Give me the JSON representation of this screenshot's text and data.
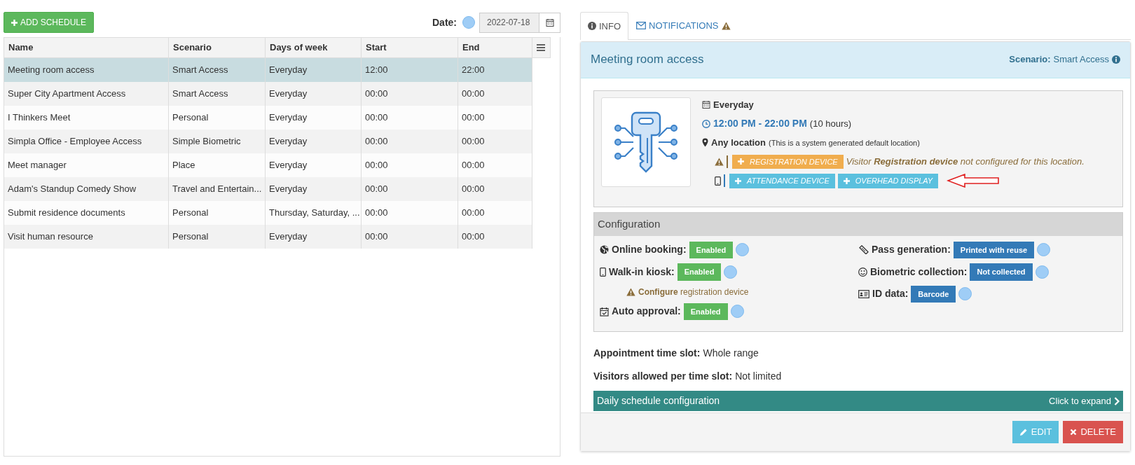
{
  "toolbar": {
    "add_button": "ADD SCHEDULE",
    "date_label": "Date:",
    "date_value": "2022-07-18"
  },
  "table": {
    "columns": [
      "Name",
      "Scenario",
      "Days of week",
      "Start",
      "End"
    ],
    "rows": [
      {
        "cells": [
          "Meeting room access",
          "Smart Access",
          "Everyday",
          "12:00",
          "22:00"
        ],
        "selected": true
      },
      {
        "cells": [
          "Super City Apartment Access",
          "Smart Access",
          "Everyday",
          "00:00",
          "00:00"
        ],
        "selected": false
      },
      {
        "cells": [
          "I Thinkers Meet",
          "Personal",
          "Everyday",
          "00:00",
          "00:00"
        ],
        "selected": false
      },
      {
        "cells": [
          "Simpla Office - Employee Access",
          "Simple Biometric",
          "Everyday",
          "00:00",
          "00:00"
        ],
        "selected": false
      },
      {
        "cells": [
          "Meet manager",
          "Place",
          "Everyday",
          "00:00",
          "00:00"
        ],
        "selected": false
      },
      {
        "cells": [
          "Adam's Standup Comedy Show",
          "Travel and Entertain...",
          "Everyday",
          "00:00",
          "00:00"
        ],
        "selected": false
      },
      {
        "cells": [
          "Submit residence documents",
          "Personal",
          "Thursday, Saturday, ...",
          "00:00",
          "00:00"
        ],
        "selected": false
      },
      {
        "cells": [
          "Visit human resource",
          "Personal",
          "Everyday",
          "00:00",
          "00:00"
        ],
        "selected": false
      }
    ]
  },
  "tabs": [
    {
      "label": "INFO",
      "selected": true,
      "warning": false
    },
    {
      "label": "NOTIFICATIONS",
      "selected": false,
      "warning": true
    }
  ],
  "detail": {
    "title": "Meeting room access",
    "scenario_label": "Scenario:",
    "scenario_value": "Smart Access",
    "days": "Everyday",
    "time": "12:00 PM - 22:00 PM",
    "duration": "(10 hours)",
    "location": "Any location",
    "location_note": "(This is a system generated default location)",
    "device_rows": [
      {
        "kind": "warning",
        "buttons": [
          "REGISTRATION DEVICE"
        ],
        "message": "Visitor **Registration device** not configured for this location."
      },
      {
        "kind": "device",
        "buttons": [
          "ATTENDANCE DEVICE",
          "OVERHEAD DISPLAY"
        ]
      }
    ],
    "configuration": {
      "title": "Configuration",
      "left": [
        {
          "label": "Online booking:",
          "value": "Enabled"
        },
        {
          "label": "Walk-in kiosk:",
          "value": "Enabled",
          "note": "**Configure** registration device"
        },
        {
          "label": "Auto approval:",
          "value": "Enabled"
        }
      ],
      "right": [
        {
          "label": "Pass generation:",
          "value": "Printed with reuse"
        },
        {
          "label": "Biometric collection:",
          "value": "Not collected"
        },
        {
          "label": "ID data:",
          "value": "Barcode"
        }
      ]
    },
    "facts": [
      {
        "label": "Appointment time slot:",
        "value": "Whole range"
      },
      {
        "label": "Visitors allowed per time slot:",
        "value": "Not limited"
      }
    ],
    "expand_bar": {
      "title": "Daily schedule configuration",
      "action": "Click to expand"
    },
    "buttons": [
      {
        "kind": "edit",
        "label": "EDIT"
      },
      {
        "kind": "delete",
        "label": "DELETE"
      }
    ]
  }
}
